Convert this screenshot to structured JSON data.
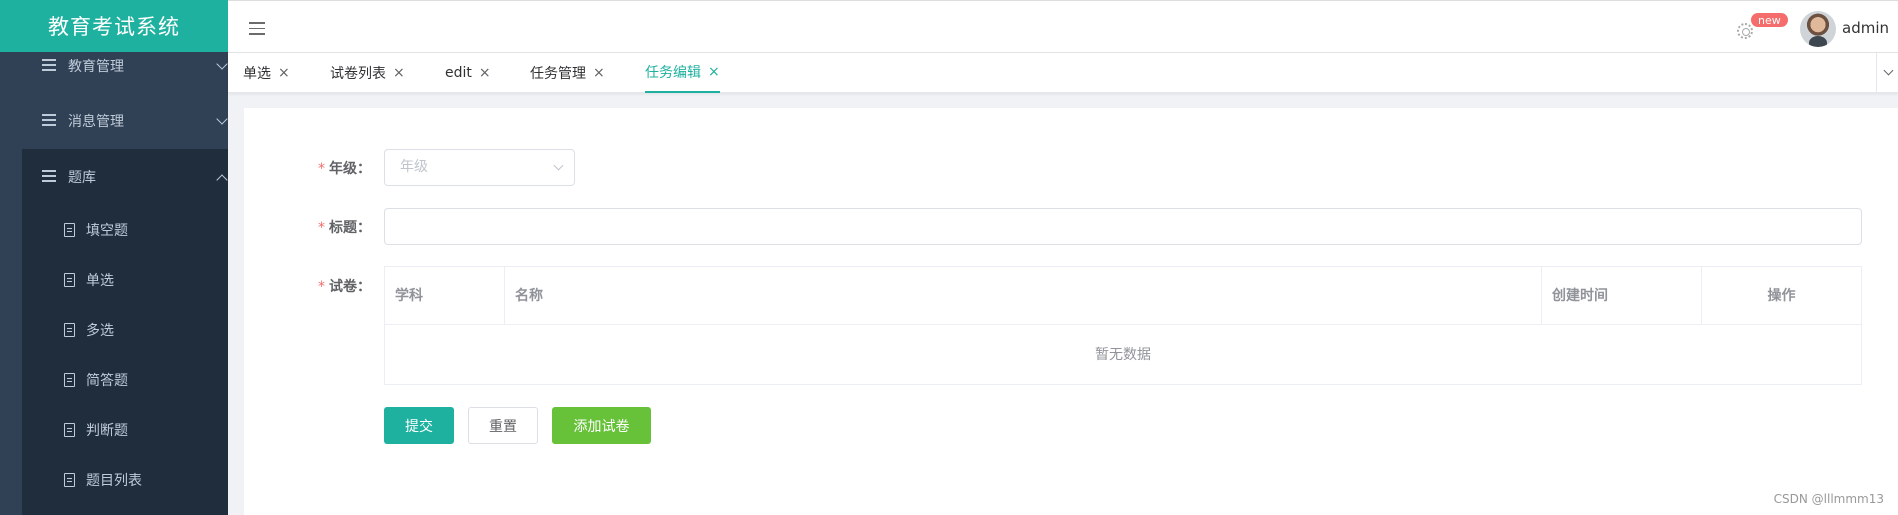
{
  "app": {
    "title": "教育考试系统"
  },
  "sidebar": {
    "menus": [
      {
        "label": "教育管理"
      },
      {
        "label": "消息管理"
      },
      {
        "label": "题库"
      }
    ],
    "submenu": [
      {
        "label": "填空题"
      },
      {
        "label": "单选"
      },
      {
        "label": "多选"
      },
      {
        "label": "简答题"
      },
      {
        "label": "判断题"
      },
      {
        "label": "题目列表"
      }
    ]
  },
  "header": {
    "badge": "new",
    "user": "admin"
  },
  "tags": [
    {
      "label": "单选",
      "close": "×"
    },
    {
      "label": "试卷列表",
      "close": "×"
    },
    {
      "label": "edit",
      "close": "×"
    },
    {
      "label": "任务管理",
      "close": "×"
    },
    {
      "label": "任务编辑",
      "close": "×",
      "active": true
    }
  ],
  "form": {
    "required_mark": "*",
    "grade": {
      "label": "年级：",
      "placeholder": "年级"
    },
    "title": {
      "label": "标题：",
      "value": ""
    },
    "paper": {
      "label": "试卷：",
      "columns": [
        "学科",
        "名称",
        "创建时间",
        "操作"
      ],
      "empty_text": "暂无数据"
    },
    "buttons": {
      "submit": "提交",
      "reset": "重置",
      "add_paper": "添加试卷"
    }
  },
  "colors": {
    "primary": "#1fb19f",
    "sidebar": "#304156",
    "success": "#67c23a",
    "danger": "#f56c6c"
  },
  "watermark": "CSDN @lllmmm13"
}
